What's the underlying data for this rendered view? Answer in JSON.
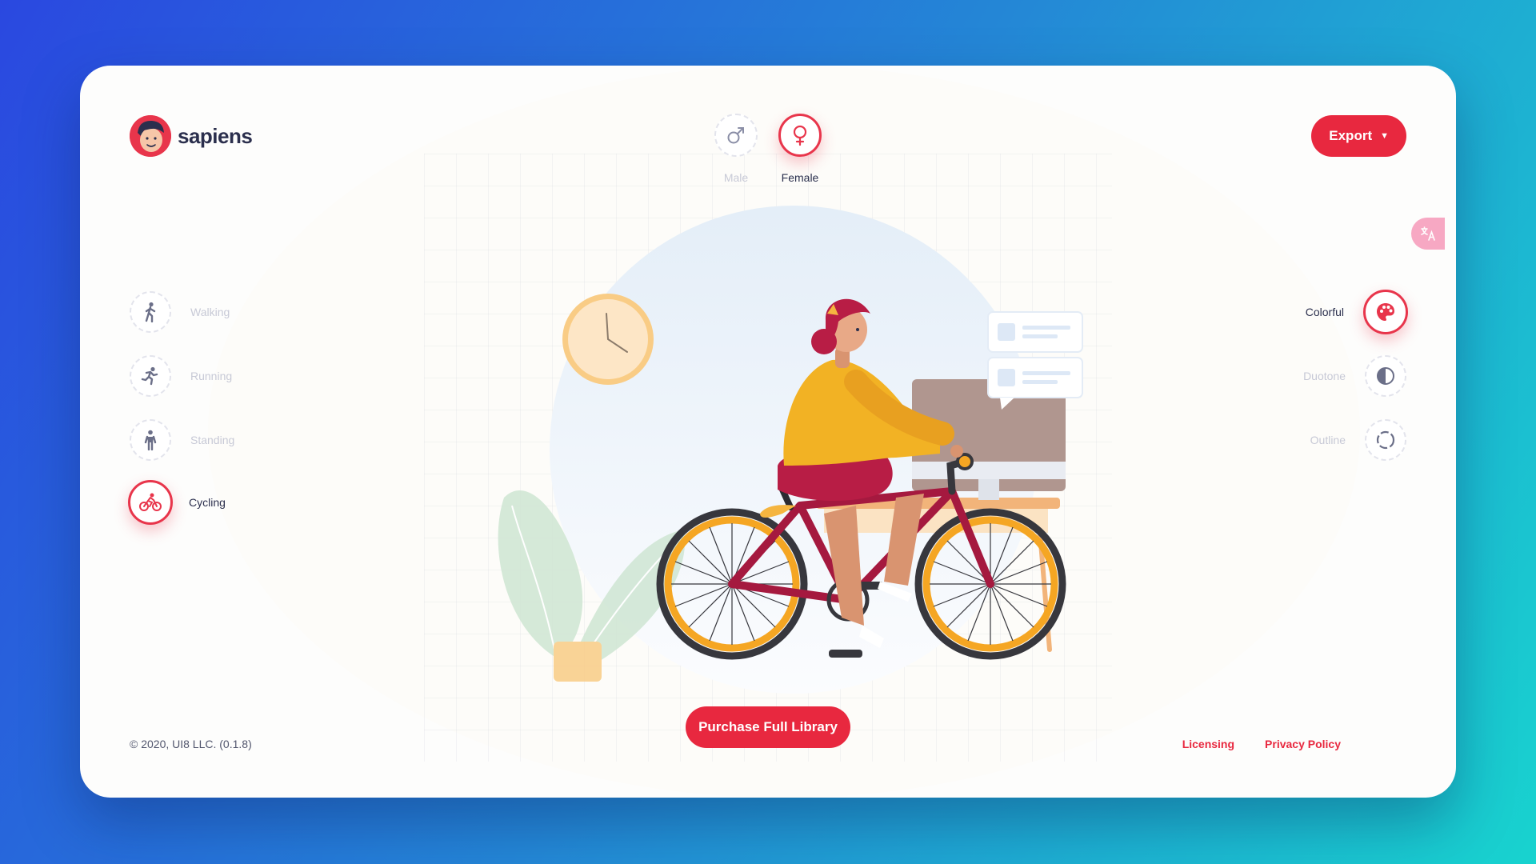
{
  "brand": {
    "name": "sapiens"
  },
  "gender": {
    "male_label": "Male",
    "female_label": "Female",
    "selected": "Female"
  },
  "export": {
    "label": "Export"
  },
  "poses": [
    {
      "label": "Walking",
      "icon": "walking-icon"
    },
    {
      "label": "Running",
      "icon": "running-icon"
    },
    {
      "label": "Standing",
      "icon": "standing-icon"
    },
    {
      "label": "Cycling",
      "icon": "cycling-icon"
    }
  ],
  "selected_pose": "Cycling",
  "styles": [
    {
      "label": "Colorful",
      "icon": "palette-icon"
    },
    {
      "label": "Duotone",
      "icon": "half-circle-icon"
    },
    {
      "label": "Outline",
      "icon": "dashed-circle-icon"
    }
  ],
  "selected_style": "Colorful",
  "translate_icon": "translate-icon",
  "purchase": {
    "label": "Purchase Full Library"
  },
  "footer": {
    "copyright": "© 2020, UI8 LLC. (0.1.8)",
    "licensing": "Licensing",
    "privacy": "Privacy Policy"
  },
  "colors": {
    "accent": "#e8283f",
    "text_dark": "#2b2f4d",
    "text_muted": "#c7c9d6"
  }
}
